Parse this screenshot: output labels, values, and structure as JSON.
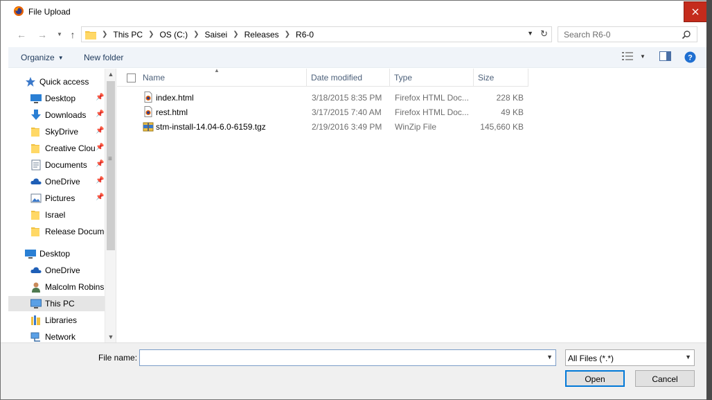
{
  "window": {
    "title": "File Upload"
  },
  "address": {
    "crumbs": [
      "This PC",
      "OS (C:)",
      "Saisei",
      "Releases",
      "R6-0"
    ]
  },
  "search": {
    "placeholder": "Search R6-0"
  },
  "toolbar": {
    "organize": "Organize",
    "new_folder": "New folder"
  },
  "nav": {
    "items": [
      {
        "label": "Quick access",
        "icon": "star-icon"
      },
      {
        "label": "Desktop",
        "icon": "desktop-icon",
        "pinned": true
      },
      {
        "label": "Downloads",
        "icon": "download-icon",
        "pinned": true
      },
      {
        "label": "SkyDrive",
        "icon": "folder-icon",
        "pinned": true
      },
      {
        "label": "Creative Clou",
        "icon": "folder-icon",
        "pinned": true
      },
      {
        "label": "Documents",
        "icon": "documents-icon",
        "pinned": true
      },
      {
        "label": "OneDrive",
        "icon": "cloud-icon",
        "pinned": true
      },
      {
        "label": "Pictures",
        "icon": "pictures-icon",
        "pinned": true
      },
      {
        "label": "Israel",
        "icon": "folder-icon"
      },
      {
        "label": "Release Docume",
        "icon": "folder-icon"
      },
      {
        "label": "Desktop",
        "icon": "desktop-icon"
      },
      {
        "label": "OneDrive",
        "icon": "cloud-icon"
      },
      {
        "label": "Malcolm Robins",
        "icon": "user-icon"
      },
      {
        "label": "This PC",
        "icon": "computer-icon",
        "selected": true
      },
      {
        "label": "Libraries",
        "icon": "libraries-icon"
      },
      {
        "label": "Network",
        "icon": "network-icon"
      }
    ]
  },
  "columns": {
    "name": "Name",
    "date": "Date modified",
    "type": "Type",
    "size": "Size"
  },
  "files": [
    {
      "name": "index.html",
      "date": "3/18/2015 8:35 PM",
      "type": "Firefox HTML Doc...",
      "size": "228 KB",
      "icon": "html-file-icon"
    },
    {
      "name": "rest.html",
      "date": "3/17/2015 7:40 AM",
      "type": "Firefox HTML Doc...",
      "size": "49 KB",
      "icon": "html-file-icon"
    },
    {
      "name": "stm-install-14.04-6.0-6159.tgz",
      "date": "2/19/2016 3:49 PM",
      "type": "WinZip File",
      "size": "145,660 KB",
      "icon": "zip-file-icon"
    }
  ],
  "footer": {
    "filename_label": "File name:",
    "filename_value": "",
    "filter": "All Files (*.*)",
    "open": "Open",
    "cancel": "Cancel"
  }
}
